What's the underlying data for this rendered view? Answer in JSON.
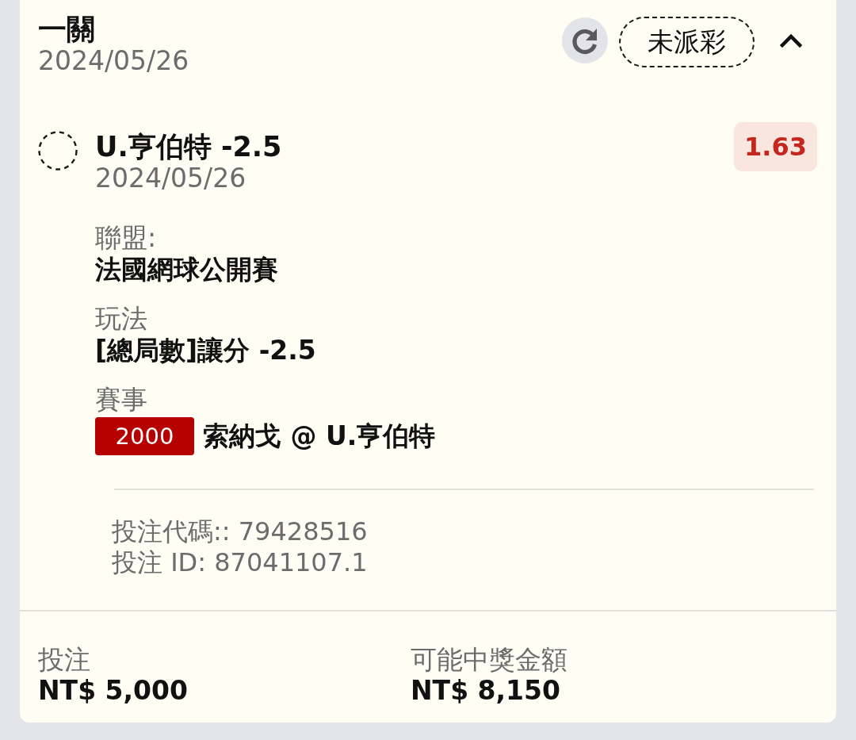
{
  "bet": {
    "title": "一關",
    "date": "2024/05/26",
    "status": "未派彩",
    "expanded": true
  },
  "selection": {
    "name": "U.亨伯特 -2.5",
    "date": "2024/05/26",
    "odds": "1.63",
    "settled": false
  },
  "details": [
    {
      "kind": "text",
      "label": "聯盟:",
      "value": "法國網球公開賽"
    },
    {
      "kind": "text",
      "label": "玩法",
      "value": "[總局數]讓分 -2.5"
    },
    {
      "kind": "event",
      "label": "賽事",
      "code": "2000",
      "value": "索納戈 @ U.亨伯特"
    }
  ],
  "references": [
    "投注代碼:: 79428516",
    "投注 ID: 87041107.1"
  ],
  "summary": [
    {
      "label": "投注",
      "value": "NT$ 5,000"
    },
    {
      "label": "可能中獎金額",
      "value": "NT$ 8,150"
    }
  ]
}
